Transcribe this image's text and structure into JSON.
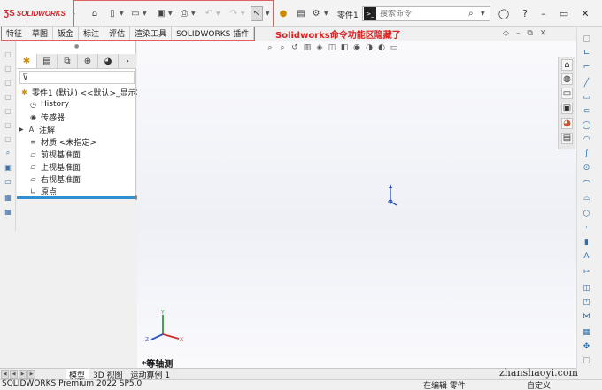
{
  "app": {
    "logo_text": "SOLIDWORKS",
    "part_name": "零件1"
  },
  "search": {
    "placeholder": "搜索命令"
  },
  "tabs": [
    {
      "label": "特征"
    },
    {
      "label": "草图"
    },
    {
      "label": "钣金"
    },
    {
      "label": "标注"
    },
    {
      "label": "评估"
    },
    {
      "label": "渲染工具"
    },
    {
      "label": "SOLIDWORKS 插件"
    }
  ],
  "annotation": "Solidworks命令功能区隐藏了",
  "tree": {
    "root": "零件1 (默认) <<默认>_显示状",
    "items": [
      {
        "label": "History",
        "icon": "history-icon"
      },
      {
        "label": "传感器",
        "icon": "sensor-icon"
      },
      {
        "label": "注解",
        "icon": "annotation-icon"
      },
      {
        "label": "材质 <未指定>",
        "icon": "material-icon"
      },
      {
        "label": "前视基准面",
        "icon": "plane-icon"
      },
      {
        "label": "上视基准面",
        "icon": "plane-icon"
      },
      {
        "label": "右视基准面",
        "icon": "plane-icon"
      },
      {
        "label": "原点",
        "icon": "origin-icon"
      }
    ]
  },
  "viewport": {
    "view_name": "*等轴测"
  },
  "bottom_tabs": [
    {
      "label": "模型"
    },
    {
      "label": "3D 视图"
    },
    {
      "label": "运动算例 1"
    }
  ],
  "status": {
    "version": "SOLIDWORKS Premium 2022 SP5.0",
    "mode": "在编辑 零件",
    "custom": "自定义"
  },
  "watermark": "zhanshaoyi.com",
  "colors": {
    "brand": "#d2232a",
    "annotation": "#e02020",
    "rollback": "#2f8fd0"
  }
}
